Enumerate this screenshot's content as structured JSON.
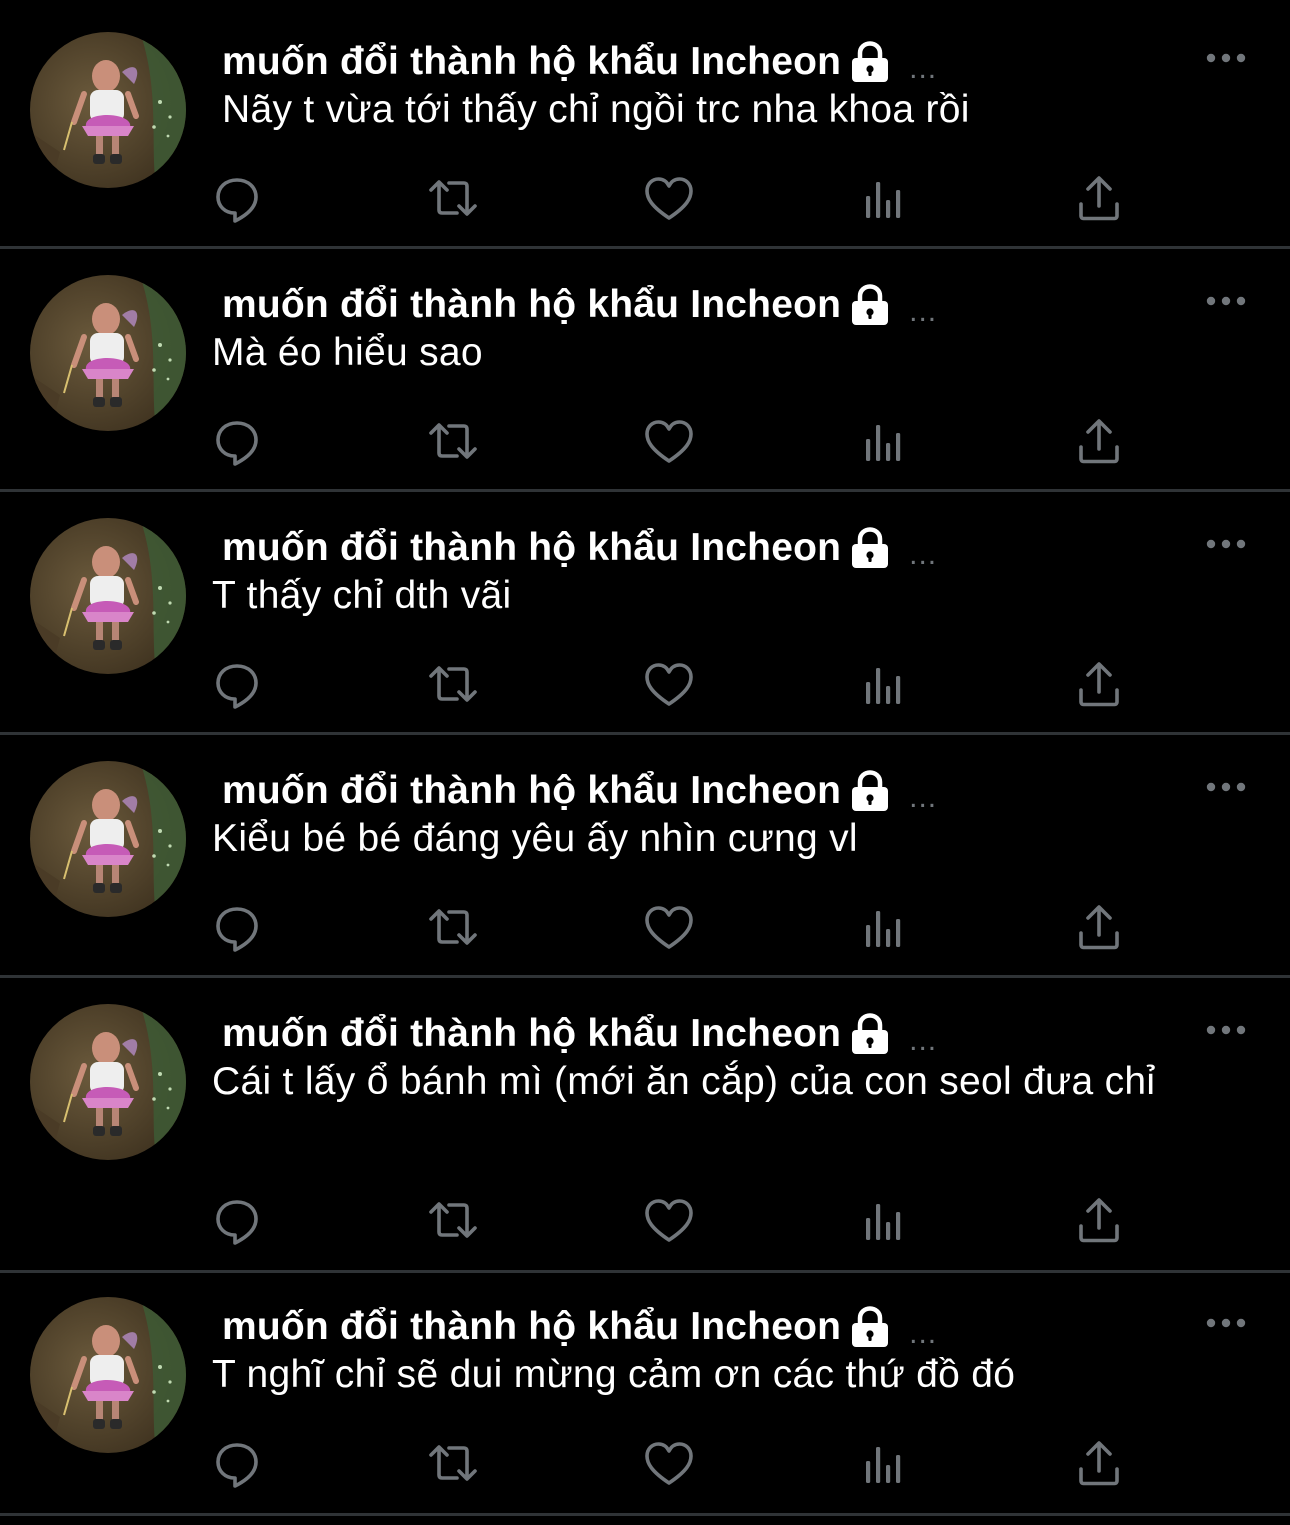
{
  "theme": {
    "background": "#000000",
    "text": "#ffffff",
    "icon": "#71767b",
    "divider": "#2f3336"
  },
  "account": {
    "display_name": "muốn đổi thành hộ khẩu Incheon",
    "protected_icon": "lock-icon",
    "truncation": "..."
  },
  "tweets": [
    {
      "text": "Nãy t vừa tới thấy chỉ ngồi trc nha khoa rồi"
    },
    {
      "text": "Mà éo hiểu sao"
    },
    {
      "text": "T thấy chỉ dth vãi"
    },
    {
      "text": "Kiểu bé bé đáng yêu ấy nhìn cưng vl"
    },
    {
      "text": "Cái t lấy ổ bánh mì (mới ăn cắp) của con seol đưa chỉ"
    },
    {
      "text": "T nghĩ chỉ sẽ dui mừng cảm ơn các thứ đồ đó"
    }
  ],
  "actions": [
    "reply-icon",
    "retweet-icon",
    "like-icon",
    "views-icon",
    "share-icon"
  ]
}
